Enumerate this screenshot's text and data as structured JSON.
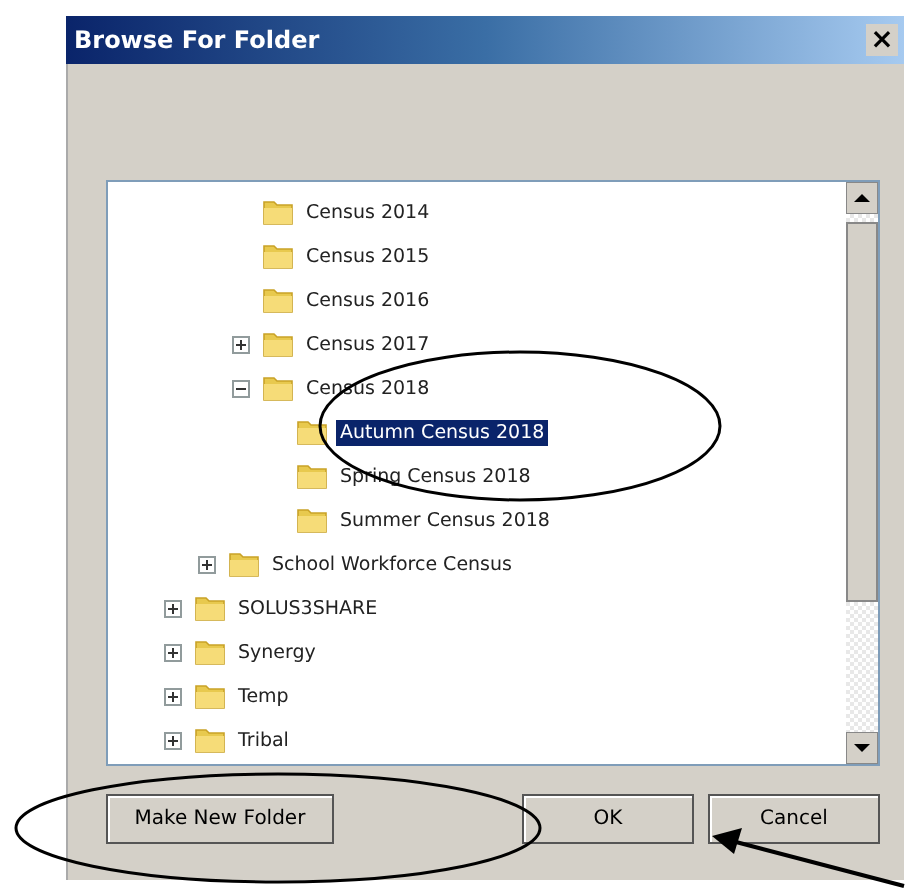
{
  "window": {
    "title": "Browse For Folder",
    "close_glyph": "×"
  },
  "tree": {
    "items": [
      {
        "children": [
          {
            "children": [
              {
                "label": "Census 2014",
                "selected": false
              },
              {
                "label": "Census 2015",
                "selected": false
              },
              {
                "label": "Census 2016",
                "selected": false
              },
              {
                "label": "Census 2017",
                "expanded": false,
                "selected": false
              },
              {
                "label": "Census 2018",
                "expanded": true,
                "selected": false,
                "children": [
                  {
                    "label": "Autumn Census 2018",
                    "selected": true
                  },
                  {
                    "label": "Spring Census 2018",
                    "selected": false
                  },
                  {
                    "label": "Summer Census 2018",
                    "selected": false
                  }
                ]
              }
            ]
          },
          {
            "label": "School Workforce Census",
            "expanded": false,
            "selected": false
          }
        ]
      },
      {
        "label": "SOLUS3SHARE",
        "expanded": false,
        "selected": false
      },
      {
        "label": "Synergy",
        "expanded": false,
        "selected": false
      },
      {
        "label": "Temp",
        "expanded": false,
        "selected": false
      },
      {
        "label": "Tribal",
        "expanded": false,
        "selected": false
      }
    ]
  },
  "buttons": [
    {
      "label": "Make New Folder"
    },
    {
      "label": "OK"
    },
    {
      "label": "Cancel"
    }
  ]
}
